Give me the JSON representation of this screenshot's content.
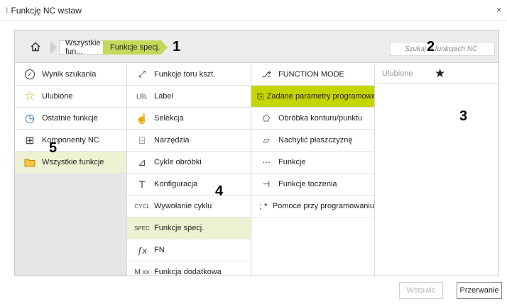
{
  "window": {
    "title": "Funkcję NC wstaw",
    "grip": "⁝",
    "close": "×"
  },
  "breadcrumb": {
    "items": [
      "Wszystkie fun...",
      "Funkcje specj."
    ]
  },
  "search": {
    "placeholder": "Szukaj w funkcjach NC"
  },
  "callouts": {
    "c1": "1",
    "c2": "2",
    "c3": "3",
    "c4": "4",
    "c5": "5"
  },
  "column1": {
    "items": [
      {
        "label": "Wynik szukania",
        "icon": "check-circle-icon",
        "glyph": "✓"
      },
      {
        "label": "Ulubione",
        "icon": "star-outline-icon",
        "glyph": "☆"
      },
      {
        "label": "Ostatnie funkcje",
        "icon": "clock-icon",
        "glyph": "◷"
      },
      {
        "label": "Komponenty NC",
        "icon": "components-icon",
        "glyph": "⊞"
      },
      {
        "label": "Wszystkie funkcje",
        "icon": "folder-icon",
        "glyph": "▭"
      }
    ]
  },
  "column2": {
    "items": [
      {
        "label": "Funkcje toru kszt.",
        "glyph": "⤢"
      },
      {
        "label": "Label",
        "glyph": "LBL"
      },
      {
        "label": "Selekcja",
        "glyph": "☝"
      },
      {
        "label": "Narzędzia",
        "glyph": "⌸"
      },
      {
        "label": "Cykle obróbki",
        "glyph": "⊿"
      },
      {
        "label": "Konfiguracja",
        "glyph": "T"
      },
      {
        "label": "Wywołanie cyklu",
        "glyph": "CYCL"
      },
      {
        "label": "Funkcje specj.",
        "glyph": "SPEC"
      },
      {
        "label": "FN",
        "glyph": "ƒx"
      },
      {
        "label": "Funkcja dodatkowa",
        "glyph": "M xx"
      }
    ]
  },
  "column3": {
    "items": [
      {
        "label": "FUNCTION MODE",
        "glyph": "⎇"
      },
      {
        "label": "Zadane parametry programowe",
        "glyph": "⎘"
      },
      {
        "label": "Obróbka konturu/punktu",
        "glyph": "⬠"
      },
      {
        "label": "Nachylić płaszczyznę",
        "glyph": "▱"
      },
      {
        "label": "Funkcje",
        "glyph": "⋯"
      },
      {
        "label": "Funkcje toczenia",
        "glyph": "⊣"
      },
      {
        "label": "Pomoce przy programowaniu",
        "glyph": "; *"
      }
    ]
  },
  "column4": {
    "header": "Ulubione",
    "star": "★"
  },
  "buttons": {
    "insert": "Wstawić",
    "cancel": "Przerwanie"
  },
  "colors": {
    "accent": "#c5d500",
    "selected": "#eef1d2",
    "breadcrumb_active": "#c6d85a"
  }
}
